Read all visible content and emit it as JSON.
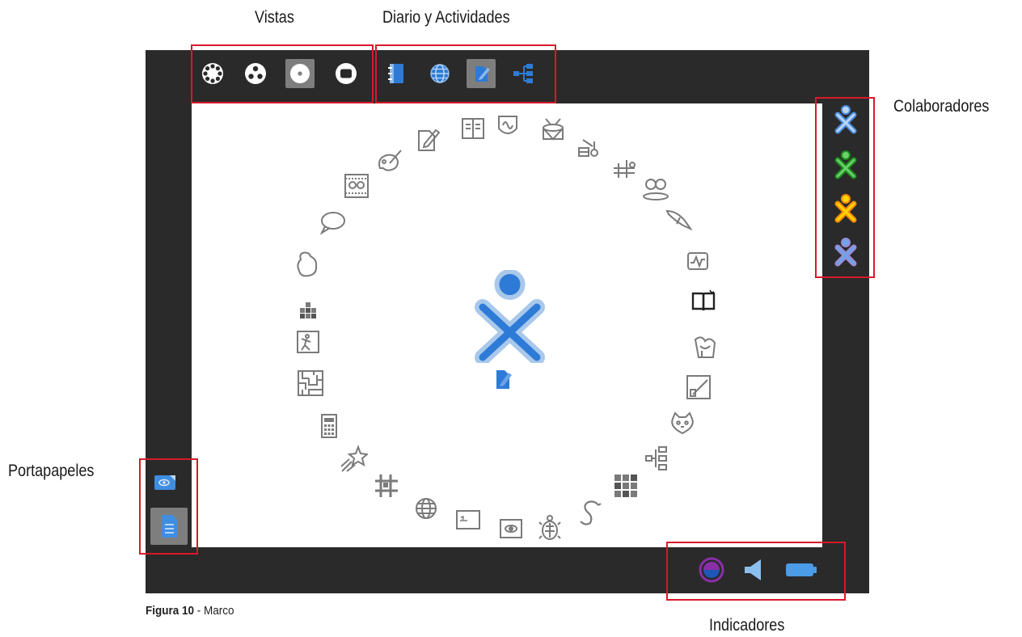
{
  "labels": {
    "views": "Vistas",
    "journal_activities": "Diario y Actividades",
    "collaborators": "Colaboradores",
    "clipboard": "Portapapeles",
    "indicators": "Indicadores"
  },
  "caption": {
    "figure": "Figura 10",
    "separator": " - ",
    "title": "Marco"
  },
  "colors": {
    "frame": "#2a2a2a",
    "highlight": "#d8192a",
    "xo_stroke": "#a9c8ea",
    "xo_fill": "#2d7bd6",
    "activity_icon": "#7a7a7a"
  },
  "views_icons": [
    "neighborhood-view-icon",
    "group-view-icon",
    "home-view-icon",
    "activity-view-icon"
  ],
  "journal_icons": [
    "journal-icon",
    "browse-icon",
    "write-icon",
    "mindmap-icon"
  ],
  "collaborators": [
    {
      "stroke": "#4a8de0",
      "fill": "#bcd6f4"
    },
    {
      "stroke": "#1b8f1b",
      "fill": "#6bd06b"
    },
    {
      "stroke": "#ff8a00",
      "fill": "#ffd400"
    },
    {
      "stroke": "#9a8ad6",
      "fill": "#6fa3e8"
    }
  ],
  "clipboard_icons": [
    "clip-image-icon",
    "clip-document-icon"
  ],
  "indicators": [
    "network-indicator-icon",
    "speaker-indicator-icon",
    "battery-indicator-icon"
  ]
}
